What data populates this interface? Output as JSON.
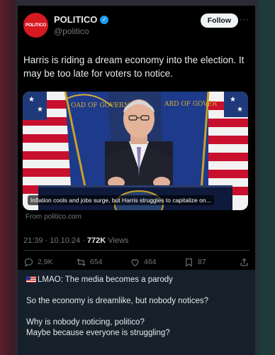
{
  "tweet": {
    "author_name": "POLITICO",
    "author_handle": "@politico",
    "avatar_text": "POLITICO",
    "follow_label": "Follow",
    "more_label": "···",
    "text": "Harris is riding a dream economy into the election. It may be too late for voters to notice.",
    "card_caption": "Inflation cools and jobs surge, but Harris struggles to capitalize on...",
    "card_source": "From politico.com",
    "timestamp": "21:39 · 10.10.24 · ",
    "views_count": "772K",
    "views_label": " Views",
    "replies": "2,9K",
    "retweets": "654",
    "likes": "464",
    "bookmarks": "87"
  },
  "comment": {
    "line1": "LMAO: The media becomes a parody",
    "line2": "So the economy is dreamlike, but nobody notices?",
    "line3": "Why is nobody noticing, politico?",
    "line4": "Maybe because everyone is struggling?"
  },
  "colors": {
    "accent": "#1d9bf0",
    "politico_red": "#d71920",
    "tweet_bg": "#000000",
    "comment_bg": "#15202b"
  },
  "icons": [
    "verified-badge-icon",
    "more-icon",
    "reply-icon",
    "retweet-icon",
    "like-icon",
    "bookmark-icon",
    "share-icon",
    "us-flag-icon"
  ]
}
